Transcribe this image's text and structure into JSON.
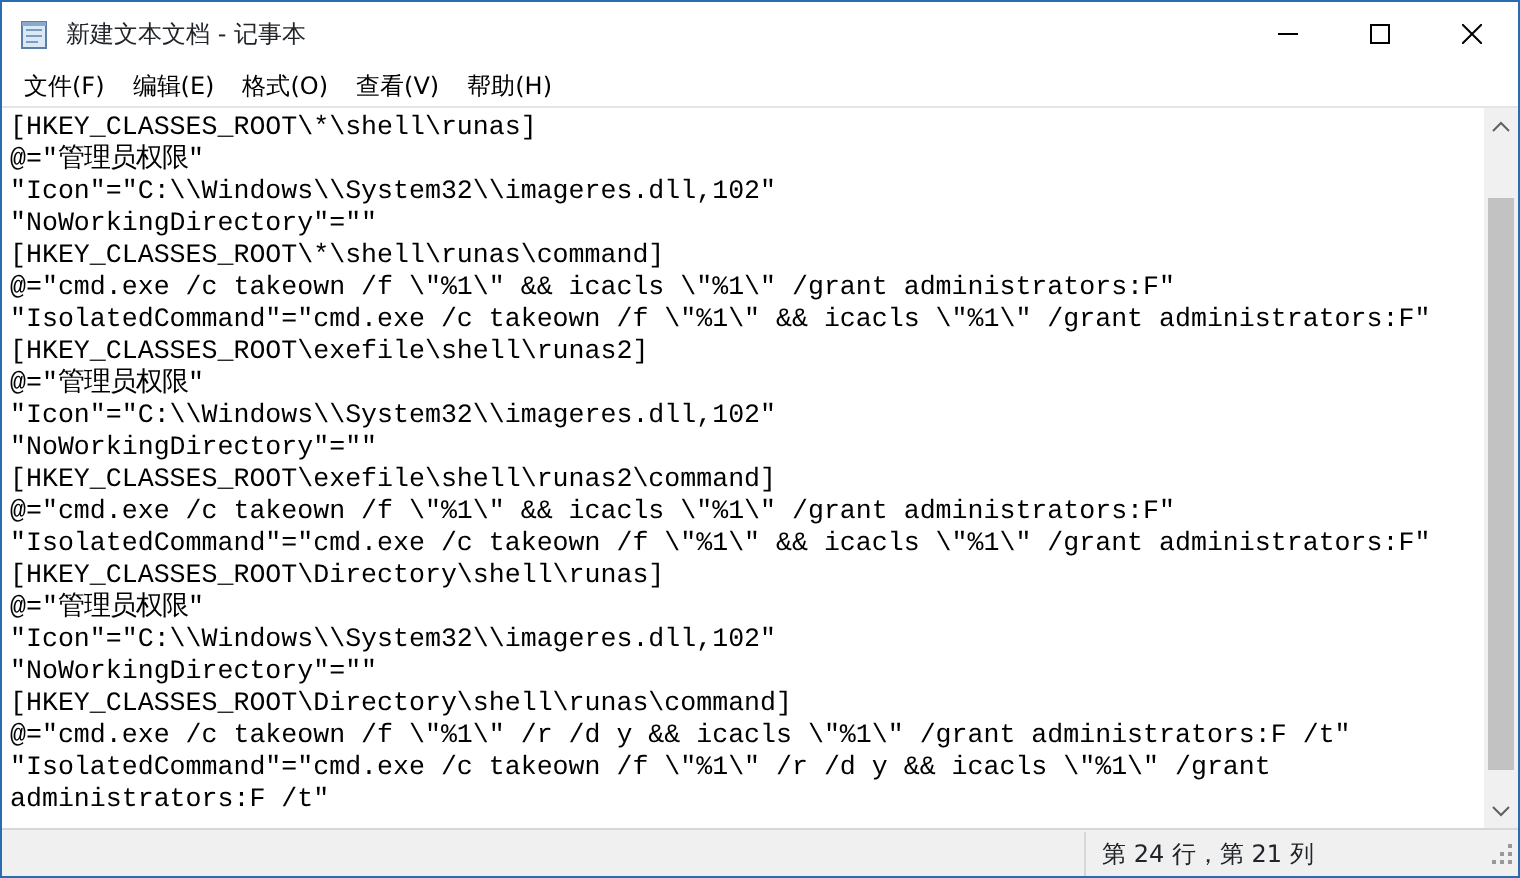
{
  "window": {
    "title": "新建文本文档 - 记事本"
  },
  "menu": [
    "文件(F)",
    "编辑(E)",
    "格式(O)",
    "查看(V)",
    "帮助(H)"
  ],
  "editor": {
    "lines": [
      "[HKEY_CLASSES_ROOT\\*\\shell\\runas]",
      "@=\"管理员权限\"",
      "\"Icon\"=\"C:\\\\Windows\\\\System32\\\\imageres.dll,102\"",
      "\"NoWorkingDirectory\"=\"\"",
      "[HKEY_CLASSES_ROOT\\*\\shell\\runas\\command]",
      "@=\"cmd.exe /c takeown /f \\\"%1\\\" && icacls \\\"%1\\\" /grant administrators:F\"",
      "\"IsolatedCommand\"=\"cmd.exe /c takeown /f \\\"%1\\\" && icacls \\\"%1\\\" /grant administrators:F\"",
      "[HKEY_CLASSES_ROOT\\exefile\\shell\\runas2]",
      "@=\"管理员权限\"",
      "\"Icon\"=\"C:\\\\Windows\\\\System32\\\\imageres.dll,102\"",
      "\"NoWorkingDirectory\"=\"\"",
      "[HKEY_CLASSES_ROOT\\exefile\\shell\\runas2\\command]",
      "@=\"cmd.exe /c takeown /f \\\"%1\\\" && icacls \\\"%1\\\" /grant administrators:F\"",
      "\"IsolatedCommand\"=\"cmd.exe /c takeown /f \\\"%1\\\" && icacls \\\"%1\\\" /grant administrators:F\"",
      "[HKEY_CLASSES_ROOT\\Directory\\shell\\runas]",
      "@=\"管理员权限\"",
      "\"Icon\"=\"C:\\\\Windows\\\\System32\\\\imageres.dll,102\"",
      "\"NoWorkingDirectory\"=\"\"",
      "[HKEY_CLASSES_ROOT\\Directory\\shell\\runas\\command]",
      "@=\"cmd.exe /c takeown /f \\\"%1\\\" /r /d y && icacls \\\"%1\\\" /grant administrators:F /t\"",
      "\"IsolatedCommand\"=\"cmd.exe /c takeown /f \\\"%1\\\" /r /d y && icacls \\\"%1\\\" /grant",
      "administrators:F /t\""
    ]
  },
  "status_bar": {
    "position": "第 24 行，第 21 列"
  }
}
